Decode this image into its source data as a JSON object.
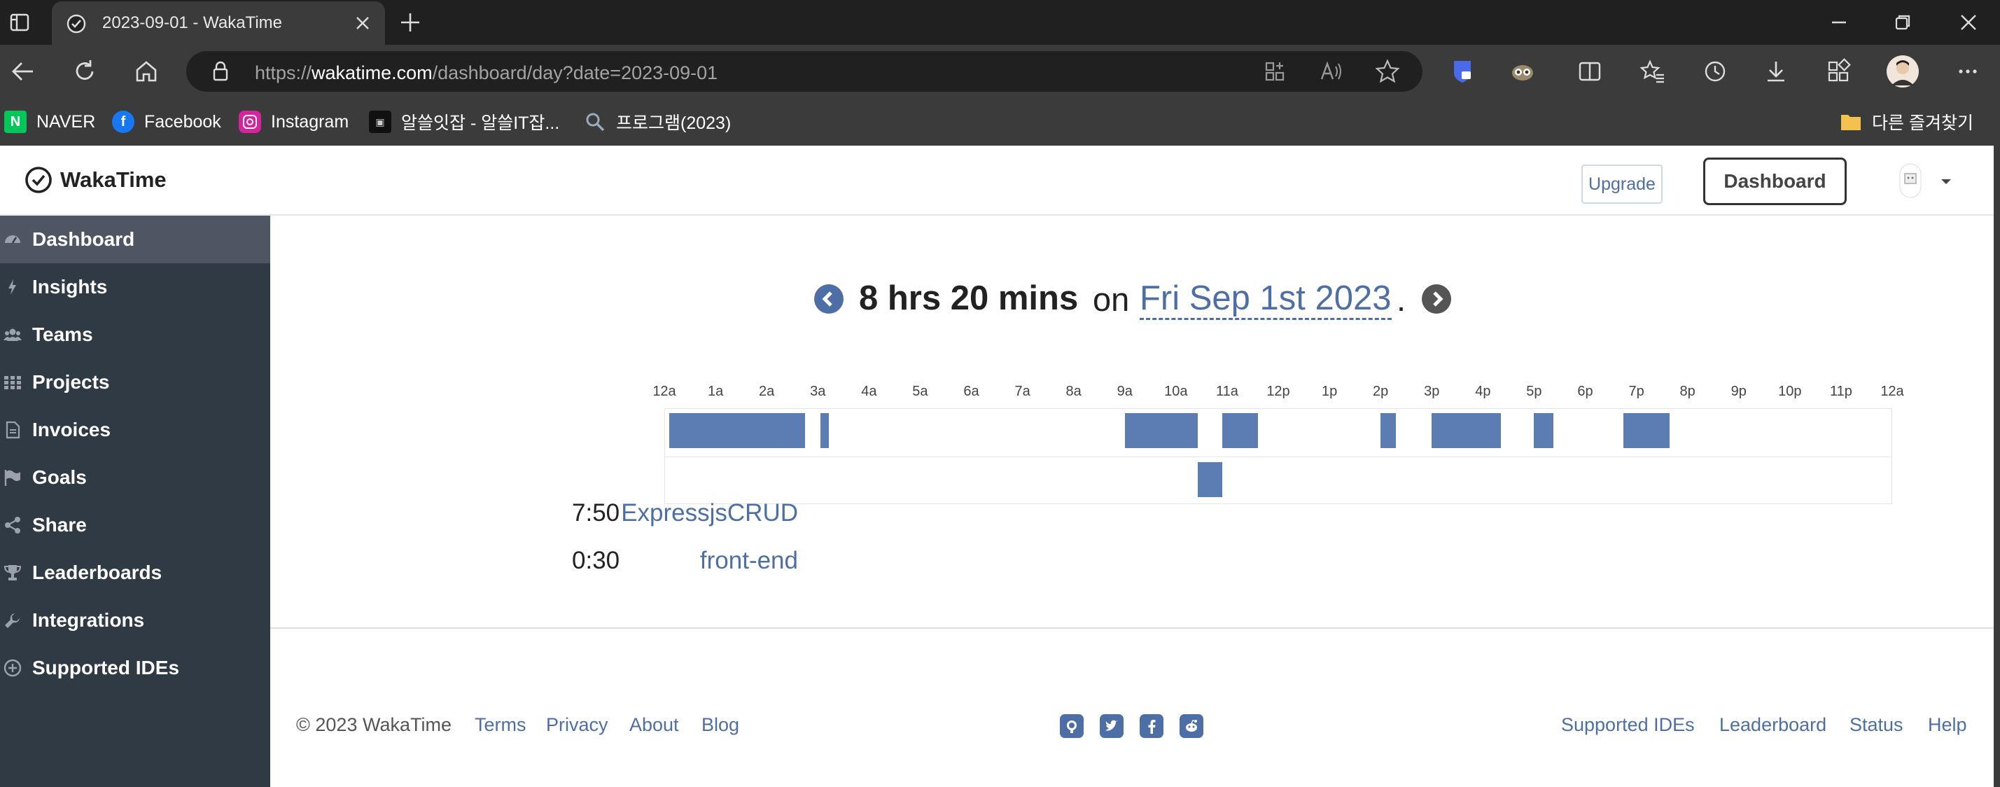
{
  "browser": {
    "tab_title": "2023-09-01 - WakaTime",
    "url_prefix": "https://",
    "url_host": "wakatime.com",
    "url_path": "/dashboard/day?date=2023-09-01",
    "bookmarks": [
      {
        "label": "NAVER",
        "icon": "naver-icon",
        "color": "#03c75a"
      },
      {
        "label": "Facebook",
        "icon": "facebook-icon",
        "color": "#1877f2"
      },
      {
        "label": "Instagram",
        "icon": "instagram-icon",
        "color": "#d6249f"
      },
      {
        "label": "알쓸잇잡 - 알쓸IT잡...",
        "icon": "site-icon",
        "color": "#111111"
      },
      {
        "label": "프로그램(2023)",
        "icon": "search-icon",
        "color": "#9ab"
      }
    ],
    "other_bookmarks": "다른 즐겨찾기"
  },
  "site": {
    "brand": "WakaTime",
    "upgrade_label": "Upgrade",
    "dashboard_label": "Dashboard"
  },
  "sidebar": {
    "items": [
      {
        "label": "Dashboard",
        "icon": "dashboard-icon",
        "active": true
      },
      {
        "label": "Insights",
        "icon": "bolt-icon"
      },
      {
        "label": "Teams",
        "icon": "users-icon"
      },
      {
        "label": "Projects",
        "icon": "grid-icon"
      },
      {
        "label": "Invoices",
        "icon": "file-icon"
      },
      {
        "label": "Goals",
        "icon": "flag-icon"
      },
      {
        "label": "Share",
        "icon": "share-icon"
      },
      {
        "label": "Leaderboards",
        "icon": "trophy-icon"
      },
      {
        "label": "Integrations",
        "icon": "wrench-icon"
      },
      {
        "label": "Supported IDEs",
        "icon": "plus-circle-icon"
      }
    ]
  },
  "day": {
    "total": "8 hrs 20 mins",
    "on": "on",
    "date": "Fri Sep 1st 2023",
    "period": "."
  },
  "timeline": {
    "hour_labels": [
      "12a",
      "1a",
      "2a",
      "3a",
      "4a",
      "5a",
      "6a",
      "7a",
      "8a",
      "9a",
      "10a",
      "11a",
      "12p",
      "1p",
      "2p",
      "3p",
      "4p",
      "5p",
      "6p",
      "7p",
      "8p",
      "9p",
      "10p",
      "11p",
      "12a"
    ],
    "projects": [
      {
        "name": "ExpressjsCRUD",
        "time": "7:50",
        "segments_hours": [
          [
            0.1,
            2.75
          ],
          [
            3.05,
            3.22
          ],
          [
            9.0,
            10.42
          ],
          [
            10.9,
            11.6
          ],
          [
            14.0,
            14.3
          ],
          [
            15.0,
            16.35
          ],
          [
            17.0,
            17.38
          ],
          [
            18.75,
            19.65
          ]
        ]
      },
      {
        "name": "front-end",
        "time": "0:30",
        "segments_hours": [
          [
            10.42,
            10.9
          ]
        ]
      }
    ],
    "bar_color": "#5b7db3"
  },
  "footer": {
    "copyright": "© 2023 WakaTime",
    "left_links": [
      "Terms",
      "Privacy",
      "About",
      "Blog"
    ],
    "social": [
      "github-icon",
      "twitter-icon",
      "facebook-icon",
      "reddit-icon"
    ],
    "right_links": [
      "Supported IDEs",
      "Leaderboard",
      "Status",
      "Help"
    ]
  }
}
